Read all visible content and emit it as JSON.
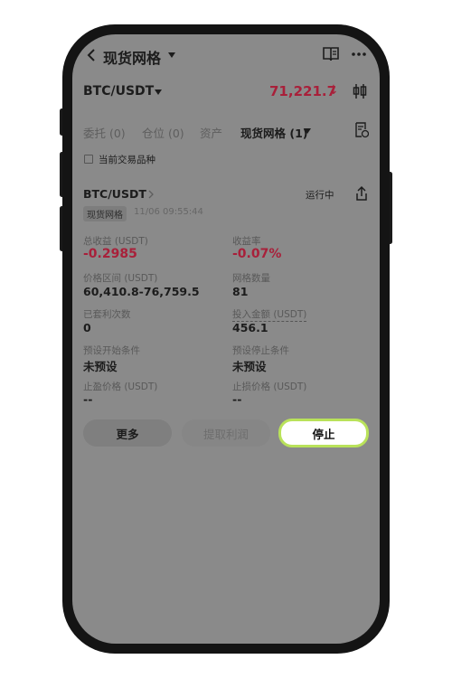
{
  "header": {
    "title": "现货网格"
  },
  "pair": {
    "symbol": "BTC/USDT",
    "price": "71,221.7",
    "price_arrow": "↓"
  },
  "tabs": [
    {
      "label": "委托 (0)"
    },
    {
      "label": "仓位 (0)"
    },
    {
      "label": "资产"
    },
    {
      "label": "现货网格 (1)"
    }
  ],
  "filter": {
    "label": "当前交易品种"
  },
  "grid_card": {
    "symbol": "BTC/USDT",
    "status": "运行中",
    "tag": "现货网格",
    "timestamp": "11/06 09:55:44",
    "fields": [
      {
        "label": "总收益 (USDT)",
        "value": "-0.2985"
      },
      {
        "label": "收益率",
        "value": "-0.07%"
      },
      {
        "label": "价格区间 (USDT)",
        "value": "60,410.8-76,759.5"
      },
      {
        "label": "网格数量",
        "value": "81"
      },
      {
        "label": "已套利次数",
        "value": "0"
      },
      {
        "label": "投入金额 (USDT)",
        "value": "456.1"
      },
      {
        "label": "预设开始条件",
        "value": "未预设"
      },
      {
        "label": "预设停止条件",
        "value": "未预设"
      },
      {
        "label": "止盈价格 (USDT)",
        "value": "--"
      },
      {
        "label": "止损价格 (USDT)",
        "value": "--"
      }
    ]
  },
  "actions": {
    "more": "更多",
    "withdraw": "提取利润",
    "stop": "停止"
  },
  "colors": {
    "negative": "#a8203a",
    "stop_border": "#b9e25a"
  }
}
